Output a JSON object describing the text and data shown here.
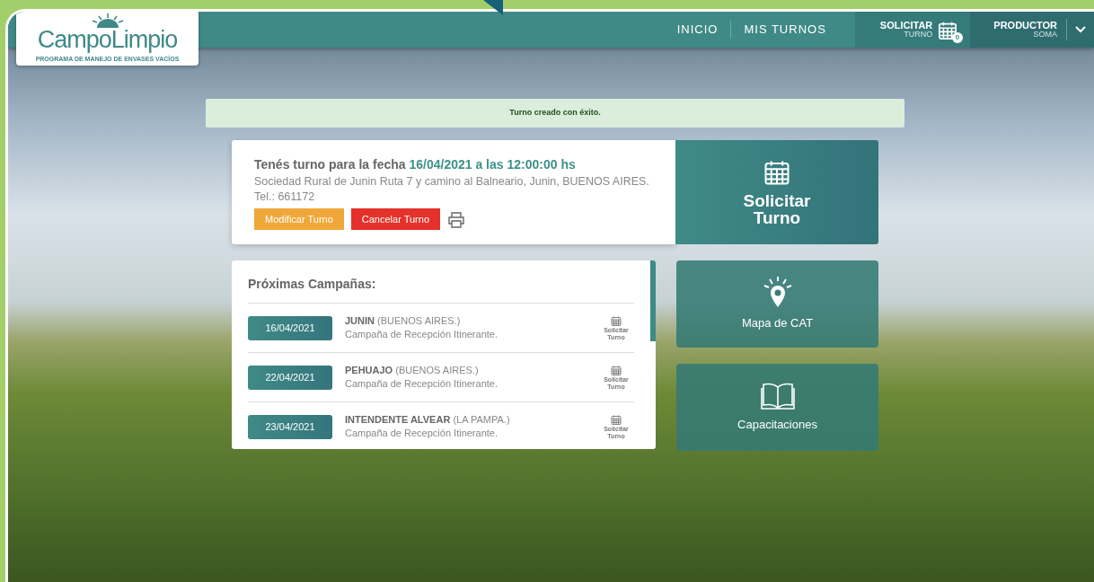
{
  "logo": {
    "name": "CampoLimpio",
    "tagline": "PROGRAMA DE MANEJO DE ENVASES VACÍOS"
  },
  "nav": {
    "links": [
      {
        "label": "INICIO"
      },
      {
        "label": "MIS TURNOS"
      }
    ],
    "request": {
      "label": "SOLICITAR",
      "sublabel": "TURNO",
      "count": "0"
    },
    "user": {
      "role": "PRODUCTOR",
      "name": "SOMA"
    }
  },
  "alert": "Turno creado con éxito.",
  "appointment": {
    "heading": "Tenés turno para la fecha",
    "datetime": "16/04/2021 a las 12:00:00 hs",
    "address": "Sociedad Rural de Junin Ruta 7 y camino al Balneario, Junin, BUENOS AIRES.",
    "phone": "Tel.: 661172",
    "buttons": [
      {
        "kind": "warning",
        "label": "Modificar Turno"
      },
      {
        "kind": "danger",
        "label": "Cancelar Turno"
      }
    ]
  },
  "campaigns": {
    "title": "Próximas Campañas:",
    "items": [
      {
        "date": "16/04/2021",
        "city": "JUNIN",
        "province": "(BUENOS AIRES.)",
        "description": "Campaña de Recepción Itinerante.",
        "action": "Solicitar Turno"
      },
      {
        "date": "22/04/2021",
        "city": "PEHUAJO",
        "province": "(BUENOS AIRES.)",
        "description": "Campaña de Recepción Itinerante.",
        "action": "Solicitar Turno"
      },
      {
        "date": "23/04/2021",
        "city": "INTENDENTE ALVEAR",
        "province": "(LA PAMPA.)",
        "description": "Campaña de Recepción Itinerante.",
        "action": "Solicitar Turno"
      }
    ]
  },
  "tiles": [
    {
      "kind": "calendar",
      "label": "Solicitar Turno"
    },
    {
      "kind": "map",
      "label": "Mapa de CAT"
    },
    {
      "kind": "book",
      "label": "Capacitaciones"
    }
  ]
}
